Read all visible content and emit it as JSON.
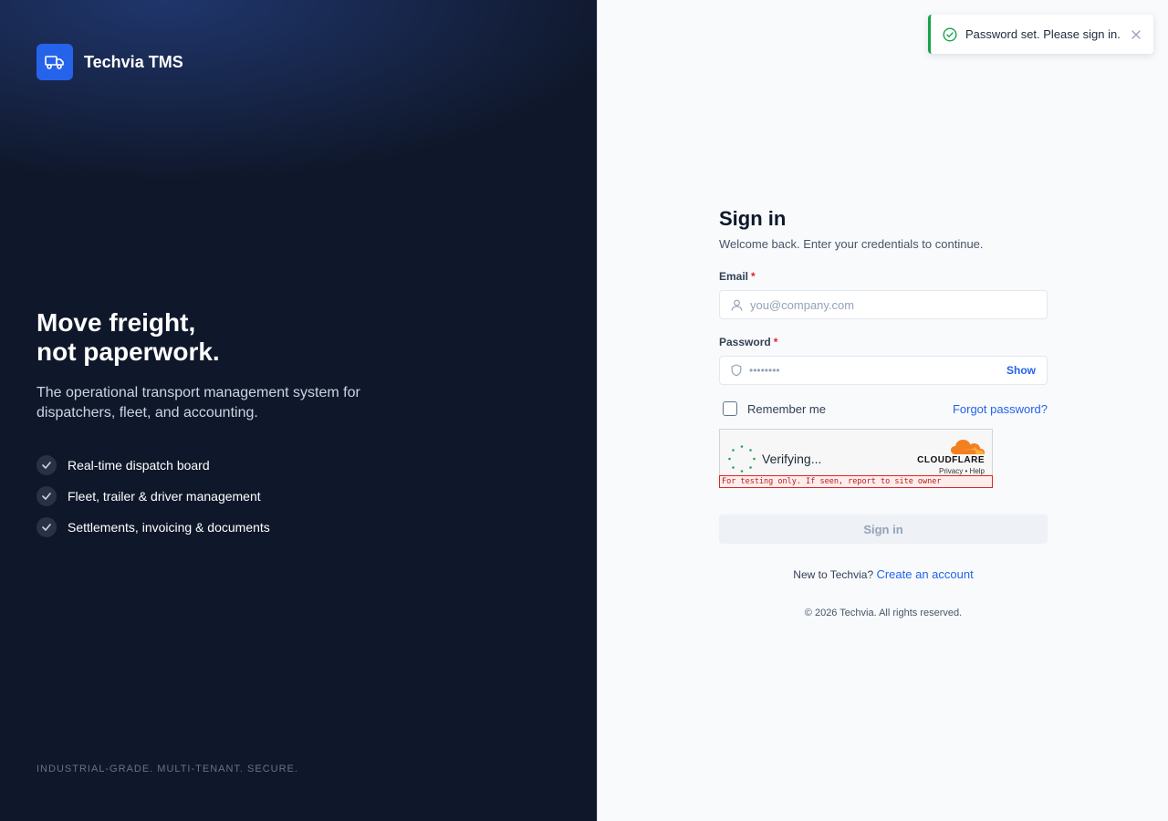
{
  "brand": {
    "name": "Techvia TMS",
    "logo_icon": "truck-icon",
    "accent": "#2563eb"
  },
  "hero": {
    "title_line1": "Move freight,",
    "title_line2": "not paperwork.",
    "subtitle": "The operational transport management system for dispatchers, fleet, and accounting.",
    "features": [
      {
        "label": "Real-time dispatch board",
        "icon": "check-icon"
      },
      {
        "label": "Fleet, trailer & driver management",
        "icon": "check-icon"
      },
      {
        "label": "Settlements, invoicing & documents",
        "icon": "check-icon"
      }
    ],
    "tagline": "INDUSTRIAL-GRADE. MULTI-TENANT. SECURE."
  },
  "form": {
    "title": "Sign in",
    "subtitle": "Welcome back. Enter your credentials to continue.",
    "email": {
      "label": "Email",
      "required_mark": "*",
      "placeholder": "you@company.com",
      "value": "",
      "icon": "user-icon"
    },
    "password": {
      "label": "Password",
      "required_mark": "*",
      "masked_value": "••••••••",
      "icon": "shield-icon",
      "show_label": "Show"
    },
    "remember_label": "Remember me",
    "forgot_label": "Forgot password?",
    "captcha": {
      "status": "Verifying...",
      "provider": "CLOUDFLARE",
      "privacy_label": "Privacy",
      "separator": "•",
      "help_label": "Help",
      "warning": "For testing only. If seen, report to site owner"
    },
    "submit_label": "Sign in",
    "new_prompt": "New to Techvia?",
    "create_account_label": "Create an account",
    "copyright": "© 2026 Techvia. All rights reserved."
  },
  "toast": {
    "message": "Password set. Please sign in.",
    "icon": "check-circle-icon",
    "status_color": "#16a34a",
    "close_icon": "close-icon"
  }
}
